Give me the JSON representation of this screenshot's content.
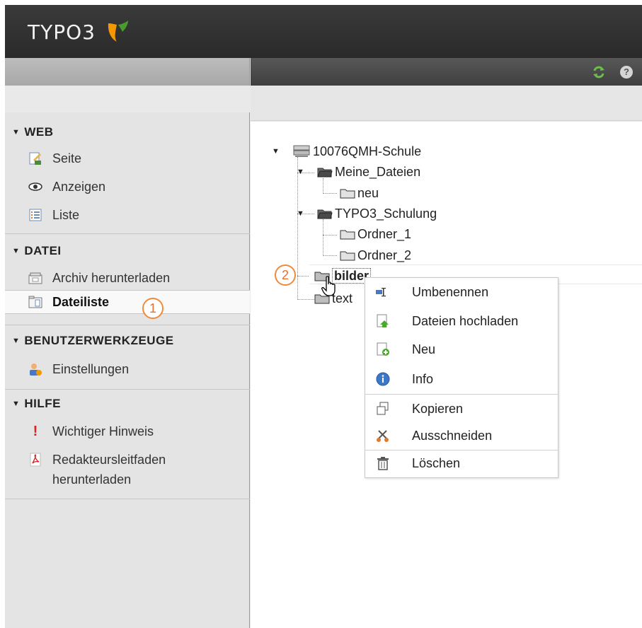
{
  "app": {
    "logo_text": "TYPO3",
    "brand_color": "#f49700"
  },
  "toolbar": {
    "refresh_icon": "refresh-icon",
    "help_icon": "help-icon",
    "help_glyph": "?"
  },
  "sidebar": {
    "groups": [
      {
        "title": "WEB",
        "items": [
          {
            "label": "Seite",
            "icon": "page-icon"
          },
          {
            "label": "Anzeigen",
            "icon": "eye-icon"
          },
          {
            "label": "Liste",
            "icon": "list-icon"
          }
        ]
      },
      {
        "title": "DATEI",
        "items": [
          {
            "label": "Archiv herunterladen",
            "icon": "archive-icon"
          },
          {
            "label": "Dateiliste",
            "icon": "filelist-icon",
            "active": true
          }
        ]
      },
      {
        "title": "BENUTZERWERKZEUGE",
        "items": [
          {
            "label": "Einstellungen",
            "icon": "user-settings-icon"
          }
        ]
      },
      {
        "title": "HILFE",
        "items": [
          {
            "label": "Wichtiger Hinweis",
            "icon": "exclamation-icon"
          },
          {
            "label": "Redakteursleitfaden",
            "label_line2": "herunterladen",
            "icon": "pdf-icon"
          }
        ]
      }
    ]
  },
  "badges": {
    "one": "1",
    "two": "2"
  },
  "tree": {
    "root": "10076QMH-Schule",
    "nodes": [
      {
        "label": "Meine_Dateien"
      },
      {
        "label": "neu"
      },
      {
        "label": "TYPO3_Schulung"
      },
      {
        "label": "Ordner_1"
      },
      {
        "label": "Ordner_2"
      },
      {
        "label": "bilder"
      },
      {
        "label": "text"
      }
    ]
  },
  "context_menu": {
    "items": [
      {
        "label": "Umbenennen",
        "icon": "rename-icon"
      },
      {
        "label": "Dateien hochladen",
        "icon": "upload-icon"
      },
      {
        "label": "Neu",
        "icon": "new-file-icon"
      },
      {
        "label": "Info",
        "icon": "info-icon"
      },
      {
        "label": "Kopieren",
        "icon": "copy-icon"
      },
      {
        "label": "Ausschneiden",
        "icon": "scissors-icon"
      },
      {
        "label": "Löschen",
        "icon": "trash-icon"
      }
    ]
  }
}
